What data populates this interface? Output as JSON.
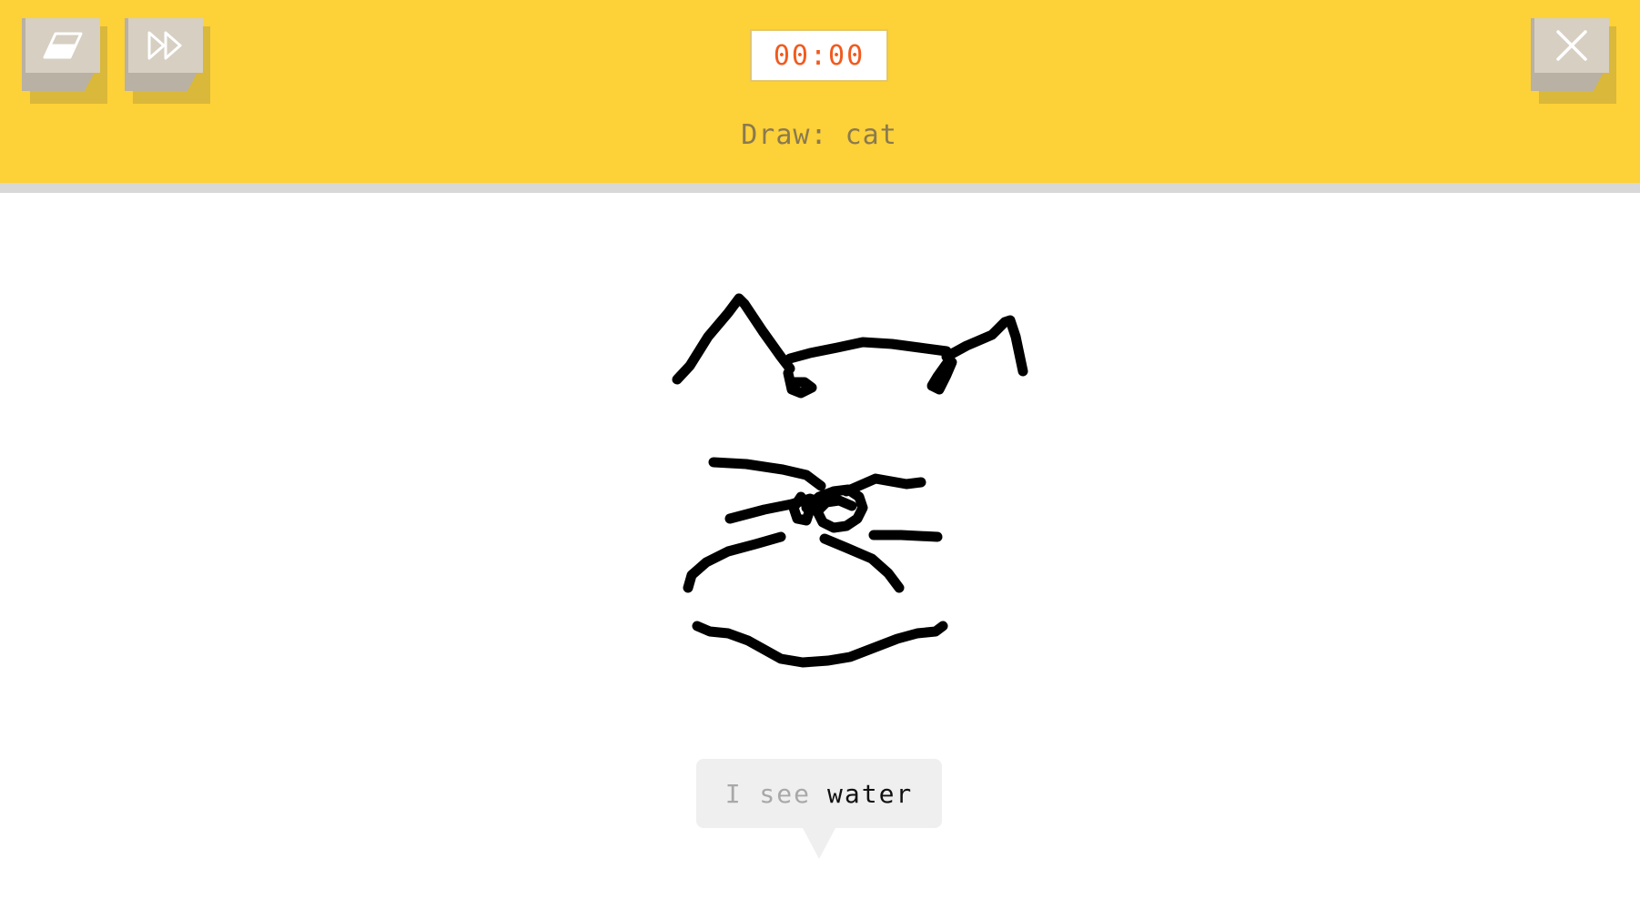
{
  "toolbar": {
    "eraser_icon": "eraser-icon",
    "skip_icon": "fast-forward-icon",
    "close_icon": "close-icon"
  },
  "timer": {
    "value": "00:00"
  },
  "prompt": {
    "label": "Draw: cat"
  },
  "guess": {
    "prefix": "I see",
    "word": "water"
  },
  "colors": {
    "topbar": "#fdd138",
    "timer_text": "#f15a1f",
    "prompt_text": "#8a7a50",
    "stroke": "#000000",
    "bubble": "#efefef"
  }
}
